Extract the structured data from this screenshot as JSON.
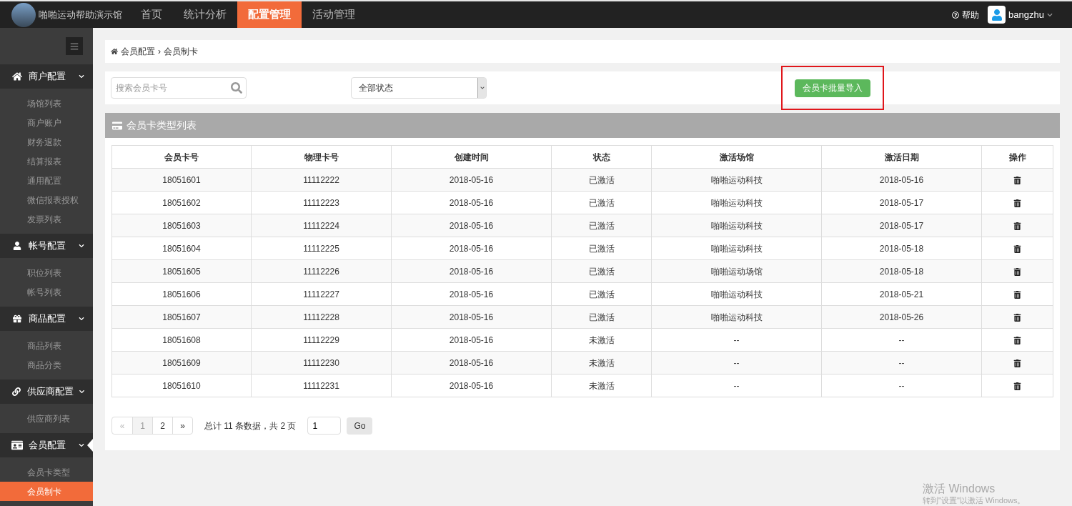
{
  "topbar": {
    "brand": "啪啪运动帮助演示馆",
    "nav": [
      {
        "label": "首页",
        "selected": false
      },
      {
        "label": "统计分析",
        "selected": false
      },
      {
        "label": "配置管理",
        "selected": true
      },
      {
        "label": "活动管理",
        "selected": false
      }
    ],
    "help": "帮助",
    "user": "bangzhu"
  },
  "sidebar": {
    "groups": [
      {
        "kind": "home",
        "label": "商户配置",
        "expanded": true,
        "items": [
          {
            "label": "场馆列表",
            "selected": false
          },
          {
            "label": "商户账户",
            "selected": false
          },
          {
            "label": "财务退款",
            "selected": false
          },
          {
            "label": "结算报表",
            "selected": false
          },
          {
            "label": "通用配置",
            "selected": false
          },
          {
            "label": "微信报表授权",
            "selected": false
          },
          {
            "label": "发票列表",
            "selected": false
          }
        ]
      },
      {
        "kind": "user",
        "label": "帐号配置",
        "expanded": true,
        "items": [
          {
            "label": "职位列表",
            "selected": false
          },
          {
            "label": "帐号列表",
            "selected": false
          }
        ]
      },
      {
        "kind": "gift",
        "label": "商品配置",
        "expanded": true,
        "items": [
          {
            "label": "商品列表",
            "selected": false
          },
          {
            "label": "商品分类",
            "selected": false
          }
        ]
      },
      {
        "kind": "link",
        "label": "供应商配置",
        "expanded": true,
        "items": [
          {
            "label": "供应商列表",
            "selected": false
          }
        ]
      },
      {
        "kind": "card",
        "label": "会员配置",
        "expanded": true,
        "items": [
          {
            "label": "会员卡类型",
            "selected": false
          },
          {
            "label": "会员制卡",
            "selected": true
          }
        ]
      }
    ]
  },
  "breadcrumb": {
    "items": [
      "会员配置",
      "会员制卡"
    ],
    "separator": "›"
  },
  "filters": {
    "search": {
      "placeholder": "搜索会员卡号"
    },
    "status_select": {
      "value": "全部状态"
    },
    "import_button": "会员卡批量导入"
  },
  "panel": {
    "title": "会员卡类型列表"
  },
  "table": {
    "columns": [
      "会员卡号",
      "物理卡号",
      "创建时间",
      "状态",
      "激活场馆",
      "激活日期",
      "操作"
    ],
    "rows": [
      [
        "18051601",
        "11112222",
        "2018-05-16",
        "已激活",
        "啪啪运动科技",
        "2018-05-16"
      ],
      [
        "18051602",
        "11112223",
        "2018-05-16",
        "已激活",
        "啪啪运动科技",
        "2018-05-17"
      ],
      [
        "18051603",
        "11112224",
        "2018-05-16",
        "已激活",
        "啪啪运动科技",
        "2018-05-17"
      ],
      [
        "18051604",
        "11112225",
        "2018-05-16",
        "已激活",
        "啪啪运动科技",
        "2018-05-18"
      ],
      [
        "18051605",
        "11112226",
        "2018-05-16",
        "已激活",
        "啪啪运动场馆",
        "2018-05-18"
      ],
      [
        "18051606",
        "11112227",
        "2018-05-16",
        "已激活",
        "啪啪运动科技",
        "2018-05-21"
      ],
      [
        "18051607",
        "11112228",
        "2018-05-16",
        "已激活",
        "啪啪运动科技",
        "2018-05-26"
      ],
      [
        "18051608",
        "11112229",
        "2018-05-16",
        "未激活",
        "--",
        "--"
      ],
      [
        "18051609",
        "11112230",
        "2018-05-16",
        "未激活",
        "--",
        "--"
      ],
      [
        "18051610",
        "11112231",
        "2018-05-16",
        "未激活",
        "--",
        "--"
      ]
    ]
  },
  "pagination": {
    "prev": {
      "label": "«",
      "disabled": true
    },
    "pages": [
      {
        "label": "1",
        "selected": true
      },
      {
        "label": "2",
        "selected": false
      }
    ],
    "next": {
      "label": "»",
      "disabled": false
    },
    "summary": "总计 11 条数据，共 2 页",
    "jump_value": "1",
    "go": "Go"
  },
  "os_notice": {
    "title": "激活 Windows",
    "text": "转到\"设置\"以激活 Windows。"
  }
}
